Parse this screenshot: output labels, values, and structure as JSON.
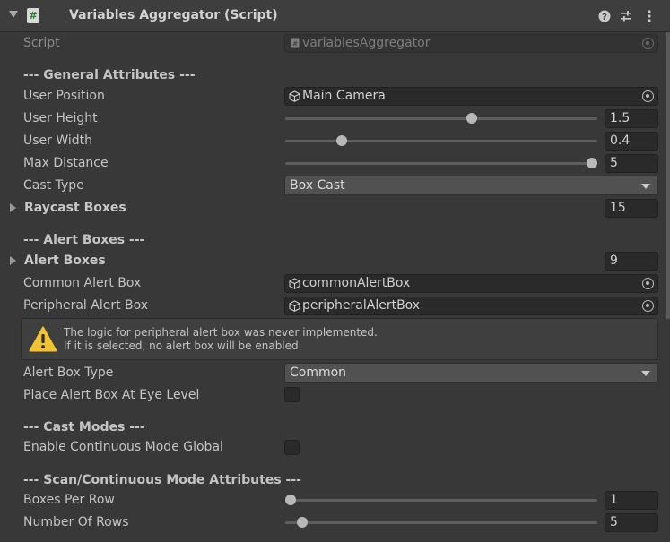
{
  "header": {
    "title": "Variables Aggregator (Script)",
    "help_icon": "help-icon",
    "preset_icon": "presets-sliders-icon",
    "menu_icon": "kebab-menu-icon"
  },
  "fields": {
    "script": {
      "label": "Script",
      "value": "variablesAggregator"
    },
    "general_header": "--- General Attributes ---",
    "user_position": {
      "label": "User Position",
      "value": "Main Camera"
    },
    "user_height": {
      "label": "User Height",
      "value": "1.5",
      "fraction": 0.6
    },
    "user_width": {
      "label": "User Width",
      "value": "0.4",
      "fraction": 0.17
    },
    "max_distance": {
      "label": "Max Distance",
      "value": "5",
      "fraction": 1.0
    },
    "cast_type": {
      "label": "Cast Type",
      "value": "Box Cast"
    },
    "raycast_boxes": {
      "label": "Raycast Boxes",
      "value": "15"
    },
    "alert_header": "--- Alert Boxes ---",
    "alert_boxes": {
      "label": "Alert Boxes",
      "value": "9"
    },
    "common_alert_box": {
      "label": "Common Alert Box",
      "value": "commonAlertBox"
    },
    "peripheral_alert_box": {
      "label": "Peripheral Alert Box",
      "value": "peripheralAlertBox"
    },
    "help": {
      "line1": "The logic for peripheral alert box was never implemented.",
      "line2": "If it is selected, no alert box will be enabled"
    },
    "alert_box_type": {
      "label": "Alert Box Type",
      "value": "Common"
    },
    "place_alert_box": {
      "label": "Place Alert Box At Eye Level",
      "checked": false
    },
    "cast_modes_header": "--- Cast Modes ---",
    "enable_continuous": {
      "label": "Enable Continuous Mode Global",
      "checked": false
    },
    "scan_header": "--- Scan/Continuous Mode Attributes ---",
    "boxes_per_row": {
      "label": "Boxes Per Row",
      "value": "1",
      "fraction": 0.0
    },
    "number_of_rows": {
      "label": "Number Of Rows",
      "value": "5",
      "fraction": 0.04
    }
  },
  "colors": {
    "background": "#383838",
    "header": "#3e3e3e",
    "field": "#2a2a2a",
    "dropdown": "#515151",
    "warning": "#f2c230"
  }
}
